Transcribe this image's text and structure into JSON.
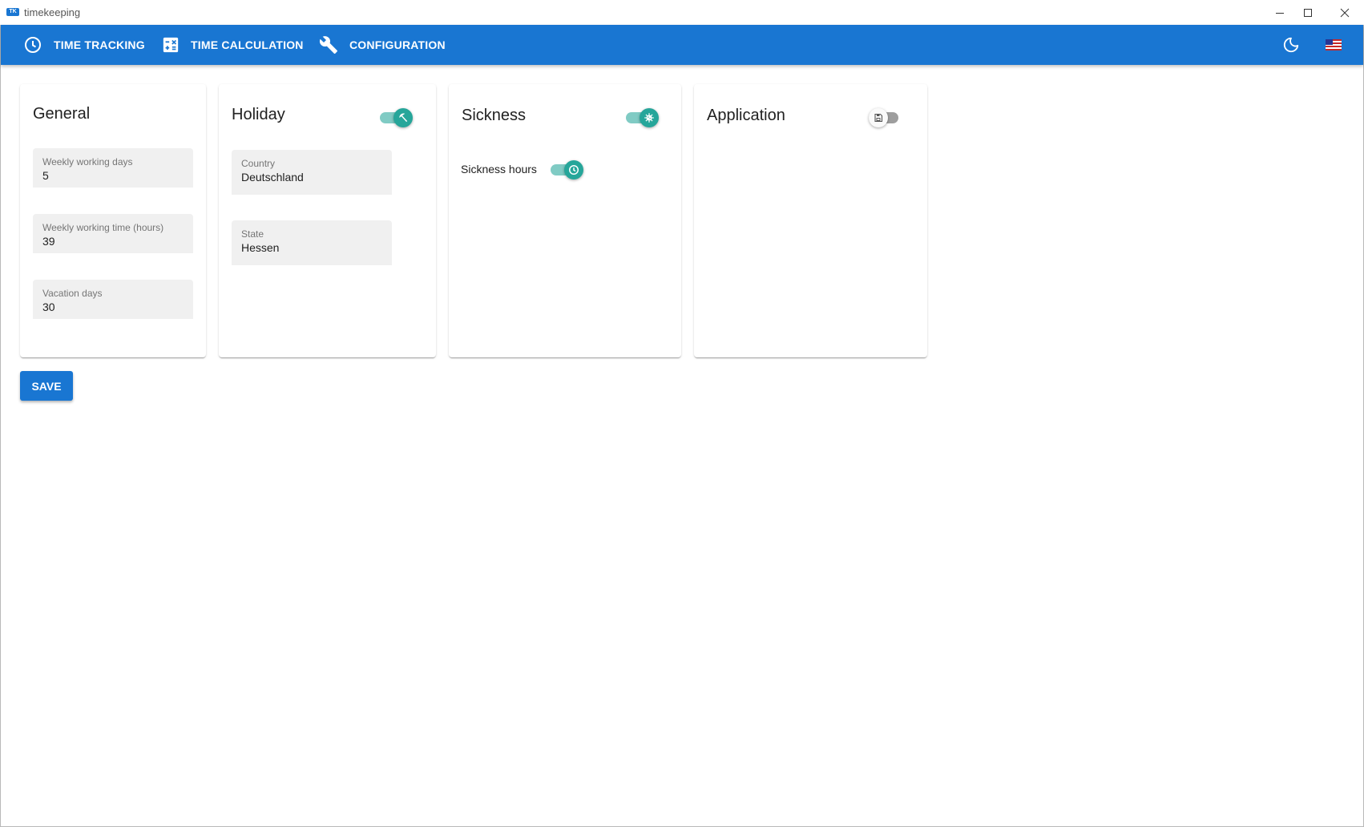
{
  "window": {
    "title": "timekeeping",
    "logo_text": "TK"
  },
  "nav": {
    "items": [
      {
        "label": "TIME TRACKING",
        "icon": "clock-icon"
      },
      {
        "label": "TIME CALCULATION",
        "icon": "calculator-icon"
      },
      {
        "label": "CONFIGURATION",
        "icon": "wrench-icon"
      }
    ],
    "theme_toggle_icon": "moon-icon",
    "language_icon": "us-flag-icon"
  },
  "cards": {
    "general": {
      "title": "General",
      "fields": [
        {
          "label": "Weekly working days",
          "value": "5"
        },
        {
          "label": "Weekly working time (hours)",
          "value": "39"
        },
        {
          "label": "Vacation days",
          "value": "30"
        }
      ]
    },
    "holiday": {
      "title": "Holiday",
      "toggle_on": true,
      "toggle_icon": "beach-umbrella-icon",
      "fields": [
        {
          "label": "Country",
          "value": "Deutschland"
        },
        {
          "label": "State",
          "value": "Hessen"
        }
      ]
    },
    "sickness": {
      "title": "Sickness",
      "toggle_on": true,
      "toggle_icon": "virus-icon",
      "hours_label": "Sickness hours",
      "hours_toggle_on": true,
      "hours_toggle_icon": "clock-icon"
    },
    "application": {
      "title": "Application",
      "toggle_on": false,
      "toggle_icon": "save-icon"
    }
  },
  "save_label": "SAVE",
  "colors": {
    "primary": "#1976d2",
    "toggle_on": "#26a69a",
    "toggle_track_on": "#80cbc4"
  }
}
